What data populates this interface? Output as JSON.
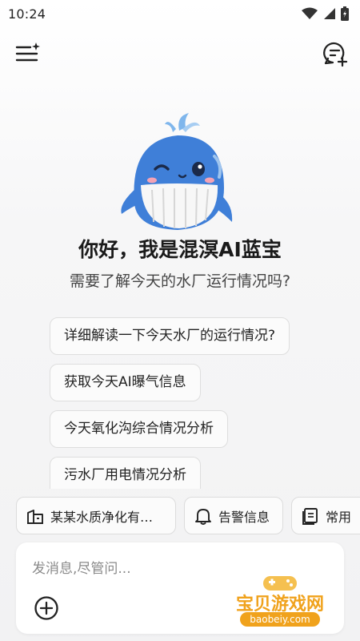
{
  "status_bar": {
    "time": "10:24"
  },
  "top_bar": {
    "menu_icon": "menu-sparkle-icon",
    "new_chat_icon": "new-chat-icon"
  },
  "greeting": {
    "title": "你好，我是混溟AI蓝宝",
    "subtitle": "需要了解今天的水厂运行情况吗?"
  },
  "suggestions": [
    {
      "label": "详细解读一下今天水厂的运行情况?"
    },
    {
      "label": "获取今天AI曝气信息"
    },
    {
      "label": "今天氧化沟综合情况分析"
    },
    {
      "label": "污水厂用电情况分析"
    }
  ],
  "quick_actions": [
    {
      "label": "某某水质净化有…",
      "icon": "building-icon"
    },
    {
      "label": "告警信息",
      "icon": "bell-icon"
    },
    {
      "label": "常用",
      "icon": "document-list-icon"
    }
  ],
  "composer": {
    "placeholder": "发消息,尽管问..."
  },
  "watermark": {
    "text": "宝贝游戏网",
    "url": "baobeiy.com"
  },
  "colors": {
    "accent": "#f0a21c",
    "mascot_blue": "#3f7fd8"
  }
}
